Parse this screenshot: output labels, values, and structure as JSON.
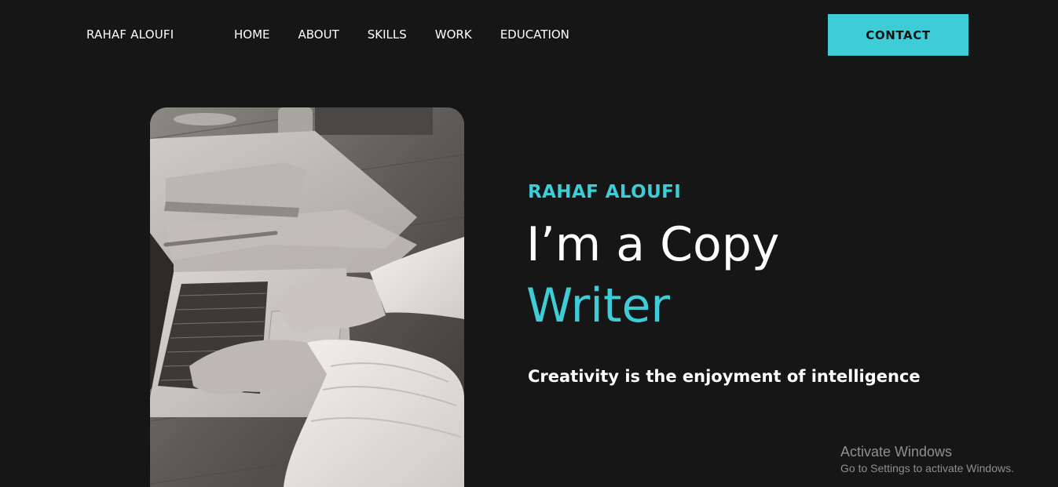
{
  "header": {
    "brand": "RAHAF ALOUFI",
    "nav": [
      {
        "label": "HOME"
      },
      {
        "label": "ABOUT"
      },
      {
        "label": "SKILLS"
      },
      {
        "label": "WORK"
      },
      {
        "label": "EDUCATION"
      }
    ],
    "contact_label": "CONTACT"
  },
  "hero": {
    "image_alt_icon": "laptop-typing-photo",
    "name": "RAHAF ALOUFI",
    "title_line1": "I’m a Copy",
    "title_line2": "Writer",
    "tagline": "Creativity is the enjoyment of intelligence"
  },
  "watermark": {
    "title": "Activate Windows",
    "subtitle": "Go to Settings to activate Windows."
  },
  "colors": {
    "background": "#161616",
    "accent": "#3ecdd6",
    "text": "#ffffff"
  }
}
